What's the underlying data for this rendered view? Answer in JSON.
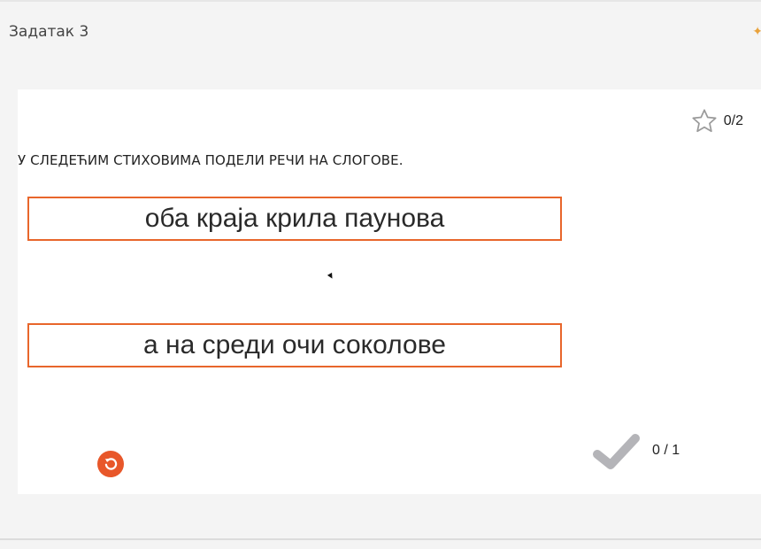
{
  "header": {
    "title": "Задатак 3"
  },
  "score": {
    "text": "0/2",
    "icon": "star-outline-icon"
  },
  "instruction": "У СЛЕДЕЋИМ СТИХОВИМА ПОДЕЛИ РЕЧИ НА СЛОГОВЕ.",
  "verses": [
    {
      "text": "оба краја крила паунова"
    },
    {
      "text": "а на среди очи соколове"
    }
  ],
  "footer": {
    "reset_icon": "reset-icon",
    "check_icon": "checkmark-icon",
    "attempts": "0 / 1"
  },
  "colors": {
    "accent": "#e8662b",
    "reset": "#e8572a",
    "check": "#b4b4b8",
    "background": "#f4f4f4",
    "card": "#ffffff"
  }
}
